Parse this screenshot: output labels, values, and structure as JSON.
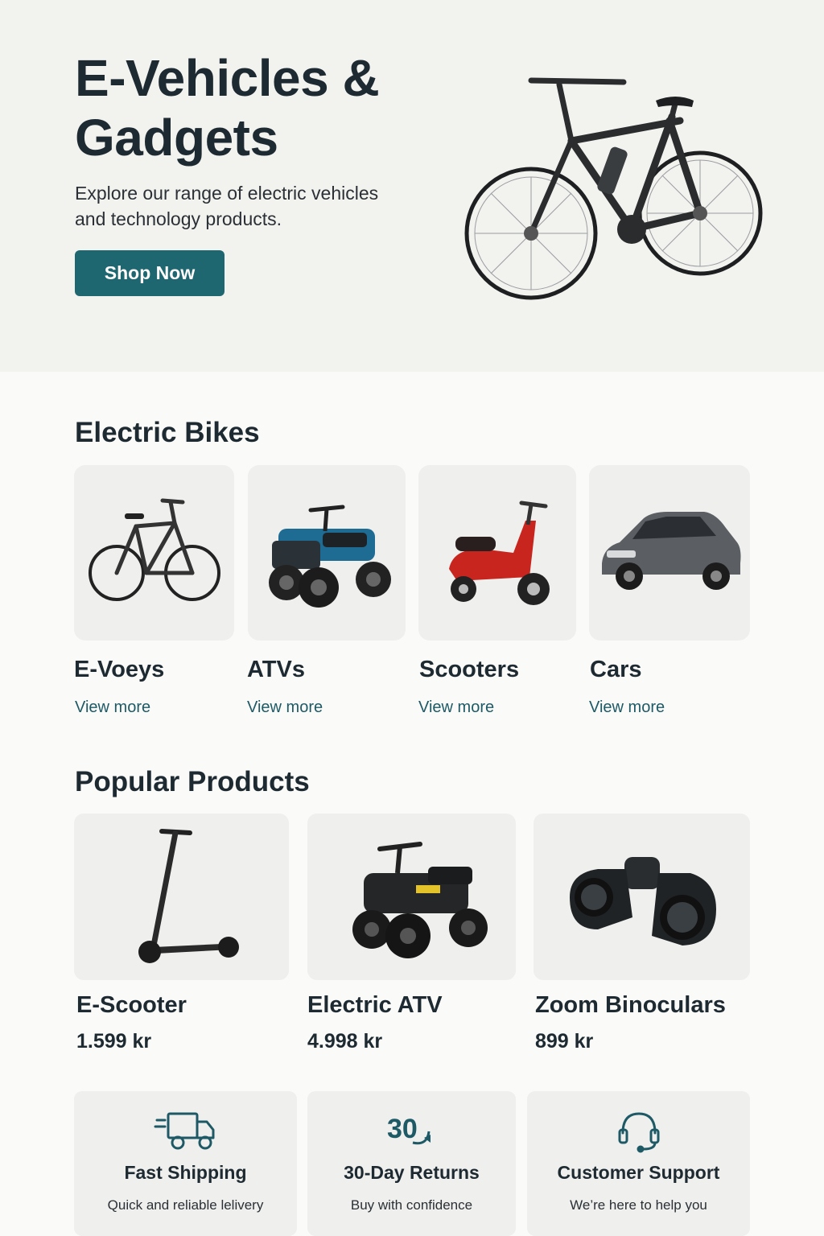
{
  "hero": {
    "title": "E-Vehicles & Gadgets",
    "subtitle": "Explore our range of electric vehicles and technology products.",
    "cta_label": "Shop Now"
  },
  "colors": {
    "accent": "#1e6670",
    "link": "#1e5a66",
    "card_bg": "#efefed",
    "hero_bg": "#f2f2ef"
  },
  "categories": {
    "title": "Electric Bikes",
    "items": [
      {
        "name": "E-Voeys",
        "link": "View more",
        "icon": "e-bike-image"
      },
      {
        "name": "ATVs",
        "link": "View more",
        "icon": "atv-image"
      },
      {
        "name": "Scooters",
        "link": "View more",
        "icon": "scooter-image"
      },
      {
        "name": "Cars",
        "link": "View more",
        "icon": "car-image"
      }
    ]
  },
  "popular": {
    "title": "Popular Products",
    "items": [
      {
        "name": "E-Scooter",
        "price": "1.599 kr",
        "icon": "kick-scooter-image"
      },
      {
        "name": "Electric ATV",
        "price": "4.998 kr",
        "icon": "electric-atv-image"
      },
      {
        "name": "Zoom Binoculars",
        "price": "899 kr",
        "icon": "binoculars-image"
      }
    ]
  },
  "features": [
    {
      "title": "Fast Shipping",
      "subtitle": "Quick and reliable lelivery",
      "icon": "truck-icon"
    },
    {
      "title": "30-Day Returns",
      "subtitle": "Buy with confidence",
      "icon": "returns-30-icon",
      "icon_text": "30"
    },
    {
      "title": "Customer Support",
      "subtitle": "We’re here to help you",
      "icon": "headset-icon"
    }
  ]
}
